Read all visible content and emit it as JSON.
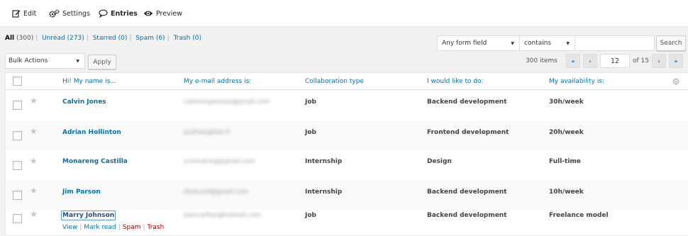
{
  "nav": {
    "edit": "Edit",
    "settings": "Settings",
    "entries": "Entries",
    "preview": "Preview"
  },
  "filters": {
    "all": "All",
    "all_count": "(300)",
    "unread": "Unread",
    "unread_count": "(273)",
    "starred": "Starred",
    "starred_count": "(0)",
    "spam": "Spam",
    "spam_count": "(6)",
    "trash": "Trash",
    "trash_count": "(0)"
  },
  "search": {
    "field_select": "Any form field",
    "operator_select": "contains",
    "value": "",
    "button": "Search"
  },
  "bulk": {
    "select": "Bulk Actions",
    "apply": "Apply"
  },
  "pagination": {
    "items": "300 items",
    "first": "«",
    "prev": "‹",
    "current_page": "12",
    "of_total": "of 15",
    "next": "›",
    "last": "»"
  },
  "columns": {
    "name": "Hi! My name is...",
    "email": "My e-mail address is:",
    "collab": "Collaboration type",
    "todo": "I would like to do:",
    "availability": "My availability is:"
  },
  "rows": [
    {
      "name": "Calvin Jones",
      "email": "calvinorganssas@gmail.com",
      "collab": "Job",
      "todo": "Backend development",
      "availability": "30h/week"
    },
    {
      "name": "Adrian Hollinton",
      "email": "audinos@live.fr",
      "collab": "Job",
      "todo": "Frontend development",
      "availability": "20h/week"
    },
    {
      "name": "Monareng Castilla",
      "email": "jcmonaring@gmail.com",
      "collab": "Internship",
      "todo": "Design",
      "availability": "Full-time"
    },
    {
      "name": "Jim Parson",
      "email": "dimtcord@gmail.com",
      "collab": "Internship",
      "todo": "Backend development",
      "availability": "10h/week"
    },
    {
      "name": "Marry Johnson",
      "email": "joancarlton@hotmail.com",
      "collab": "Job",
      "todo": "Backend development",
      "availability": "Freelance model"
    }
  ],
  "row_actions": {
    "view": "View",
    "mark_read": "Mark read",
    "spam": "Spam",
    "trash": "Trash"
  },
  "colors": {
    "link": "#0073aa",
    "danger": "#a00",
    "text": "#444"
  }
}
